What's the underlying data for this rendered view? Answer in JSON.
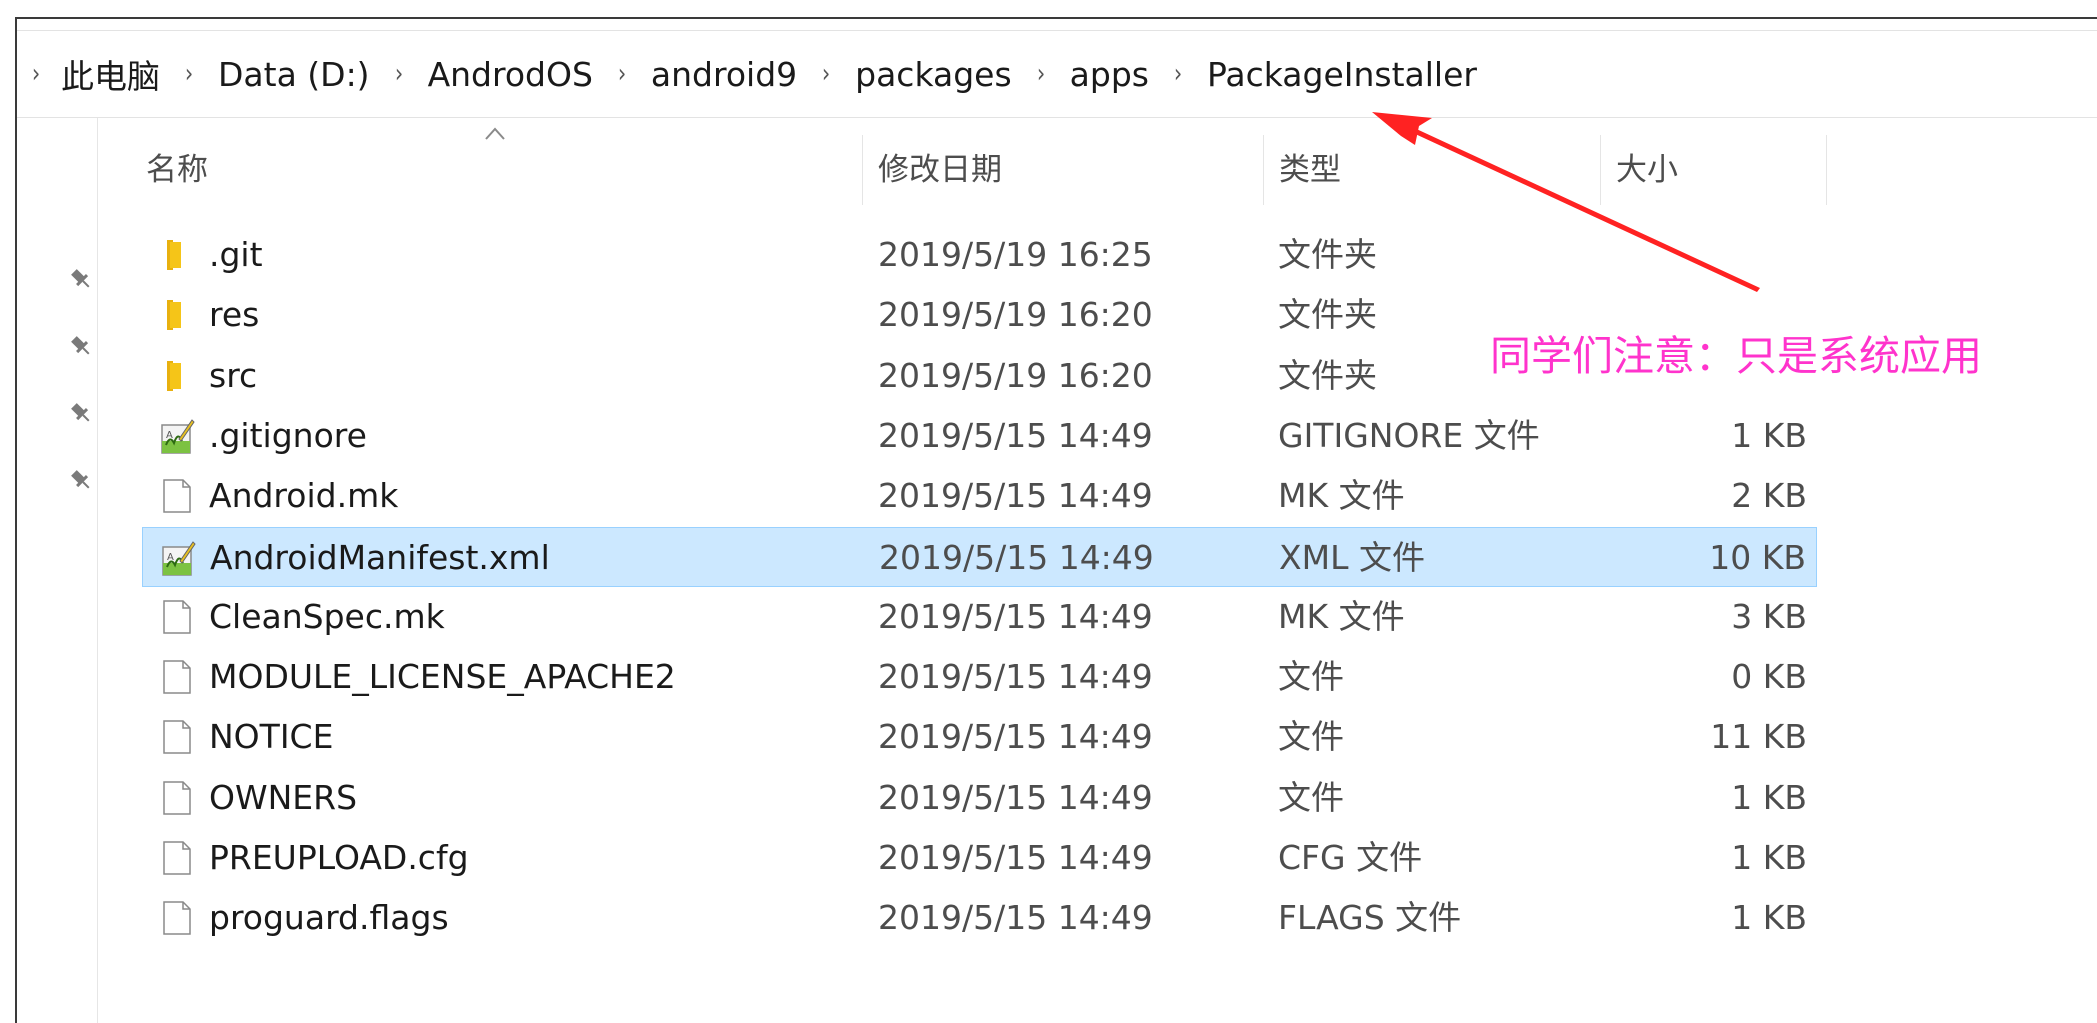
{
  "breadcrumb": {
    "items": [
      "此电脑",
      "Data (D:)",
      "AndrodOS",
      "android9",
      "packages",
      "apps",
      "PackageInstaller"
    ]
  },
  "columns": {
    "name": "名称",
    "date": "修改日期",
    "type": "类型",
    "size": "大小",
    "sort_indicator": "ascending"
  },
  "files": [
    {
      "name": ".git",
      "date": "2019/5/19 16:25",
      "type": "文件夹",
      "size": "",
      "icon": "folder-icon"
    },
    {
      "name": "res",
      "date": "2019/5/19 16:20",
      "type": "文件夹",
      "size": "",
      "icon": "folder-icon"
    },
    {
      "name": "src",
      "date": "2019/5/19 16:20",
      "type": "文件夹",
      "size": "",
      "icon": "folder-icon"
    },
    {
      "name": ".gitignore",
      "date": "2019/5/15 14:49",
      "type": "GITIGNORE 文件",
      "size": "1 KB",
      "icon": "notepad-file-icon"
    },
    {
      "name": "Android.mk",
      "date": "2019/5/15 14:49",
      "type": "MK 文件",
      "size": "2 KB",
      "icon": "blank-file-icon"
    },
    {
      "name": "AndroidManifest.xml",
      "date": "2019/5/15 14:49",
      "type": "XML 文件",
      "size": "10 KB",
      "icon": "notepad-file-icon",
      "selected": true
    },
    {
      "name": "CleanSpec.mk",
      "date": "2019/5/15 14:49",
      "type": "MK 文件",
      "size": "3 KB",
      "icon": "blank-file-icon"
    },
    {
      "name": "MODULE_LICENSE_APACHE2",
      "date": "2019/5/15 14:49",
      "type": "文件",
      "size": "0 KB",
      "icon": "blank-file-icon"
    },
    {
      "name": "NOTICE",
      "date": "2019/5/15 14:49",
      "type": "文件",
      "size": "11 KB",
      "icon": "blank-file-icon"
    },
    {
      "name": "OWNERS",
      "date": "2019/5/15 14:49",
      "type": "文件",
      "size": "1 KB",
      "icon": "blank-file-icon"
    },
    {
      "name": "PREUPLOAD.cfg",
      "date": "2019/5/15 14:49",
      "type": "CFG 文件",
      "size": "1 KB",
      "icon": "blank-file-icon"
    },
    {
      "name": "proguard.flags",
      "date": "2019/5/15 14:49",
      "type": "FLAGS 文件",
      "size": "1 KB",
      "icon": "blank-file-icon"
    }
  ],
  "quick_access_pins": 4,
  "annotation": {
    "text": "同学们注意：只是系统应用",
    "color": "#ff33cc",
    "arrow_color": "#ff2222"
  },
  "colors": {
    "selection_bg": "#cce8ff",
    "selection_border": "#99d1ff",
    "folder": "#f5c518"
  }
}
